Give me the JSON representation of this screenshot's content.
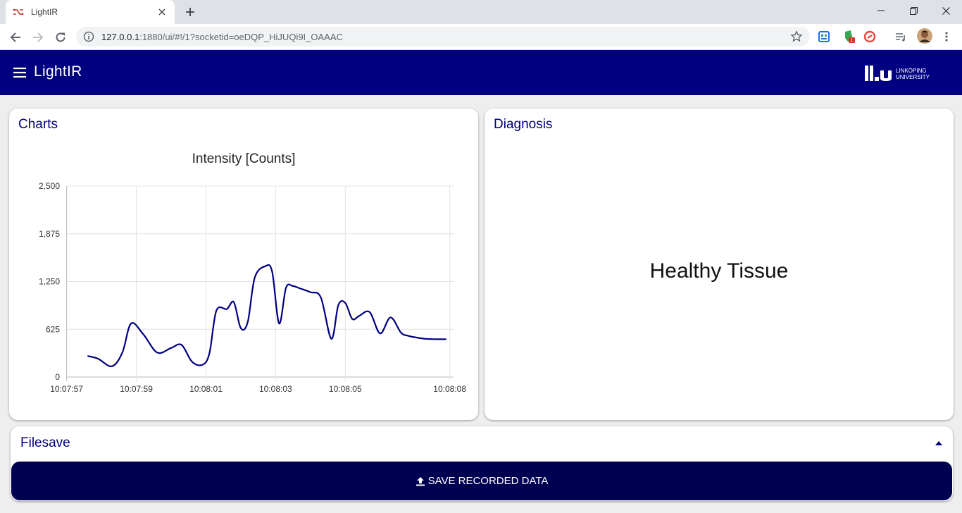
{
  "browser": {
    "tab_title": "LightIR",
    "url_host": "127.0.0.1",
    "url_rest": ":1880/ui/#!/1?socketid=oeDQP_HiJUQi9I_OAAAC",
    "extension_badge": "1"
  },
  "app": {
    "title": "LightIR",
    "logo_line1": "LINKÖPING",
    "logo_line2": "UNIVERSITY"
  },
  "charts_card": {
    "title": "Charts"
  },
  "diagnosis_card": {
    "title": "Diagnosis",
    "result": "Healthy Tissue"
  },
  "filesave_card": {
    "title": "Filesave",
    "save_button_label": "SAVE RECORDED DATA"
  },
  "colors": {
    "brand": "#000080",
    "button": "#000050",
    "line": "#000080"
  },
  "chart_data": {
    "type": "line",
    "title": "Intensity [Counts]",
    "xlabel": "",
    "ylabel": "",
    "ylim": [
      0,
      2500
    ],
    "yticks": [
      "0",
      "625",
      "1,250",
      "1,875",
      "2,500"
    ],
    "ytick_values": [
      0,
      625,
      1250,
      1875,
      2500
    ],
    "xticks": [
      "10:07:57",
      "10:07:59",
      "10:08:01",
      "10:08:03",
      "10:08:05",
      "10:08:08"
    ],
    "xtick_seconds": [
      57,
      59,
      61,
      63,
      65,
      68
    ],
    "grid": true,
    "series": [
      {
        "name": "",
        "x_seconds": [
          57.6,
          57.9,
          58.3,
          58.6,
          58.85,
          59.2,
          59.6,
          60.0,
          60.3,
          60.6,
          60.9,
          61.1,
          61.3,
          61.6,
          61.8,
          62.0,
          62.2,
          62.4,
          62.7,
          62.9,
          63.1,
          63.3,
          63.5,
          63.7,
          64.0,
          64.3,
          64.6,
          64.8,
          65.0,
          65.2,
          65.4,
          65.7,
          66.0,
          66.3,
          66.6,
          66.8,
          67.0,
          67.3,
          67.6,
          67.9
        ],
        "values": [
          275,
          240,
          140,
          320,
          700,
          560,
          320,
          380,
          420,
          200,
          160,
          310,
          870,
          890,
          980,
          640,
          720,
          1300,
          1450,
          1380,
          700,
          1170,
          1190,
          1160,
          1110,
          1040,
          500,
          940,
          970,
          760,
          800,
          850,
          570,
          780,
          580,
          540,
          520,
          500,
          495,
          495
        ]
      }
    ]
  }
}
